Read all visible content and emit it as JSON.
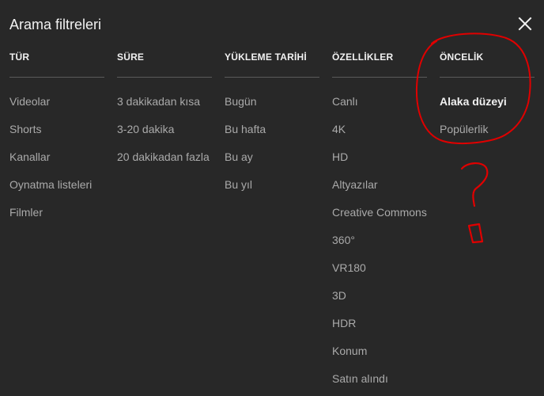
{
  "dialog": {
    "title": "Arama filtreleri",
    "close_icon": "close-icon"
  },
  "columns": [
    {
      "header": "TÜR",
      "items": [
        "Videolar",
        "Shorts",
        "Kanallar",
        "Oynatma listeleri",
        "Filmler"
      ]
    },
    {
      "header": "SÜRE",
      "items": [
        "3 dakikadan kısa",
        "3-20 dakika",
        "20 dakikadan fazla"
      ]
    },
    {
      "header": "YÜKLEME TARİHİ",
      "items": [
        "Bugün",
        "Bu hafta",
        "Bu ay",
        "Bu yıl"
      ]
    },
    {
      "header": "ÖZELLİKLER",
      "items": [
        "Canlı",
        "4K",
        "HD",
        "Altyazılar",
        "Creative Commons",
        "360°",
        "VR180",
        "3D",
        "HDR",
        "Konum",
        "Satın alındı"
      ]
    },
    {
      "header": "ÖNCELİK",
      "items": [
        "Alaka düzeyi",
        "Popülerlik"
      ],
      "selected": "Alaka düzeyi"
    }
  ],
  "colors": {
    "background": "#282828",
    "text_primary": "#f1f1f1",
    "text_secondary": "#aaaaaa",
    "divider": "#5a5a5a",
    "annotation": "#e00000"
  }
}
